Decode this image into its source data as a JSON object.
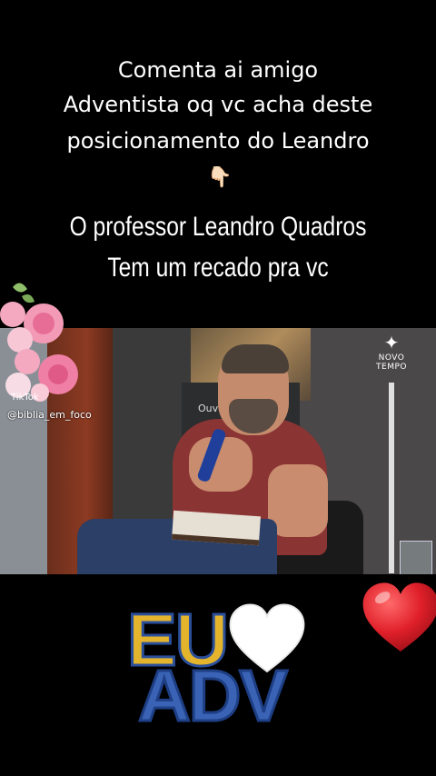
{
  "caption": {
    "line1": "Comenta ai amigo",
    "line2": "Adventista oq vc acha deste",
    "line3": "posicionamento do Leandro",
    "pointer_icon": "👇🏻"
  },
  "subtitle": {
    "line1": "O professor Leandro Quadros",
    "line2": "Tem um recado pra vc"
  },
  "video": {
    "banner_text": "Ouvin",
    "logo_text": "NOVO TEMPO",
    "watermark_user": "@biblia_em_foco",
    "watermark_app": "TikTok"
  },
  "sticker": {
    "eu": "EU",
    "adv": "ADV"
  },
  "colors": {
    "background": "#000000",
    "heart_red": "#e0202a",
    "eu_yellow": "#e4b52c",
    "adv_blue": "#3a63b5"
  }
}
